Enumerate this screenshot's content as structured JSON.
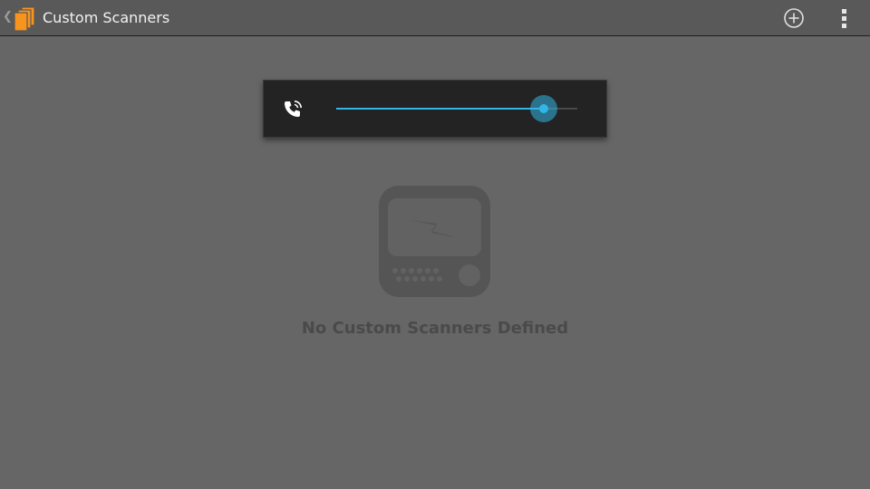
{
  "action_bar": {
    "title": "Custom Scanners",
    "icons": {
      "back": "chevron-left-icon",
      "app": "stacked-pages-icon",
      "add": "add-circle-icon",
      "overflow": "overflow-menu-icon"
    }
  },
  "volume_dialog": {
    "icon": "phone-call-icon",
    "level_percent": 86,
    "accent_color": "#33b5e5"
  },
  "empty_state": {
    "icon": "scanner-radio-icon",
    "message": "No Custom Scanners Defined"
  },
  "colors": {
    "background": "#666666",
    "action_bar": "#595959",
    "app_icon": "#f7941d"
  }
}
